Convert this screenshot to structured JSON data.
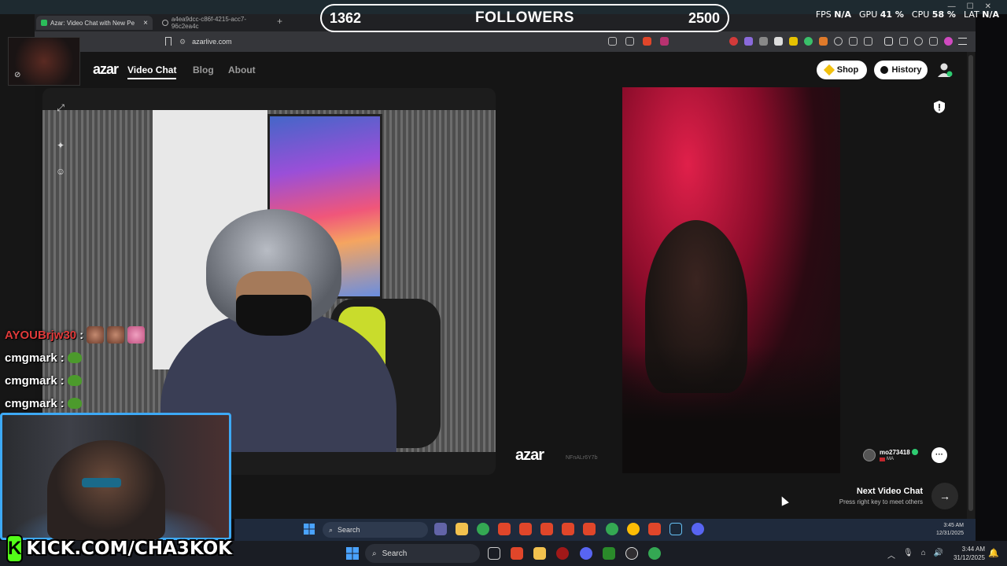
{
  "overlay": {
    "followers": {
      "current": "1362",
      "title": "FOLLOWERS",
      "goal": "2500"
    },
    "perf": {
      "fps_label": "FPS",
      "fps_value": "N/A",
      "gpu_label": "GPU",
      "gpu_value": "41 %",
      "cpu_label": "CPU",
      "cpu_value": "58 %",
      "lat_label": "LAT",
      "lat_value": "N/A"
    },
    "chat": [
      {
        "user": "AYOUBrjw30",
        "message": ":",
        "user_color": "#e03a3a"
      },
      {
        "user": "cmgmark",
        "message": ":",
        "user_color": "#ffffff"
      },
      {
        "user": "cmgmark",
        "message": ":",
        "user_color": "#ffffff"
      },
      {
        "user": "cmgmark",
        "message": ":",
        "user_color": "#ffffff"
      }
    ],
    "kick_logo": "K",
    "kick_url": "KICK.COM/CHA3KOK",
    "brand_color": "#53fc18",
    "cam_border_color": "#3da9f5"
  },
  "browser": {
    "tabs": [
      {
        "title": "Azar: Video Chat with New Pe",
        "icon": "azar-favicon"
      },
      {
        "title": "a4ea9dcc-c86f-4215-acc7-96c2ea4c",
        "icon": "globe-icon"
      }
    ],
    "new_tab": "+",
    "close_tab": "×",
    "url": "azarlive.com"
  },
  "site": {
    "logo": "azar",
    "nav": [
      {
        "label": "Video Chat",
        "active": true
      },
      {
        "label": "Blog",
        "active": false
      },
      {
        "label": "About",
        "active": false
      }
    ],
    "shop_label": "Shop",
    "history_label": "History",
    "watermark": "azar",
    "watermark_id": "NFnALr6Y7b",
    "peer": {
      "name": "mo273418",
      "country": "MA"
    },
    "next": {
      "title": "Next Video Chat",
      "hint": "Press right key to meet others",
      "arrow": "→"
    },
    "chat_icon": "···"
  },
  "inner_taskbar": {
    "search_placeholder": "Search",
    "time": "3:45 AM",
    "date": "12/31/2025"
  },
  "taskbar": {
    "search_placeholder": "Search",
    "time": "3:44 AM",
    "date": "31/12/2025"
  }
}
